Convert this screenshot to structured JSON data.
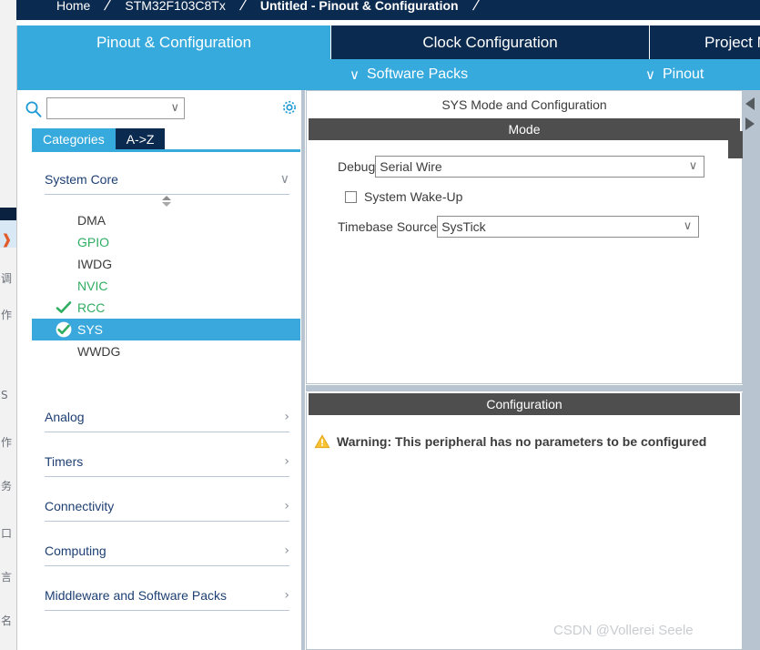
{
  "breadcrumb": {
    "items": [
      {
        "label": "Home",
        "current": false
      },
      {
        "label": "STM32F103C8Tx",
        "current": false
      },
      {
        "label": "Untitled - Pinout & Configuration",
        "current": true
      }
    ],
    "separator": "/"
  },
  "tabs": [
    {
      "label": "Pinout & Configuration",
      "active": true
    },
    {
      "label": "Clock Configuration",
      "active": false
    },
    {
      "label": "Project Manager",
      "active": false
    }
  ],
  "subtoolbar": {
    "software_packs": "Software Packs",
    "pinout": "Pinout",
    "chevron": "∨"
  },
  "sidebar": {
    "search": {
      "value": "",
      "placeholder": "",
      "icon": "search-icon",
      "chevron": "∨"
    },
    "gear_icon": "gear-icon",
    "view_tabs": [
      {
        "label": "Categories",
        "active": true
      },
      {
        "label": "A->Z",
        "active": false
      }
    ],
    "groups": [
      {
        "label": "System Core",
        "expanded": true,
        "chevron": "∨",
        "items": [
          {
            "label": "DMA",
            "state": "plain",
            "mark": "none"
          },
          {
            "label": "GPIO",
            "state": "green",
            "mark": "none"
          },
          {
            "label": "IWDG",
            "state": "plain",
            "mark": "none"
          },
          {
            "label": "NVIC",
            "state": "green",
            "mark": "none"
          },
          {
            "label": "RCC",
            "state": "check",
            "mark": "check"
          },
          {
            "label": "SYS",
            "state": "selected",
            "mark": "check-circle"
          },
          {
            "label": "WWDG",
            "state": "plain",
            "mark": "none"
          }
        ]
      },
      {
        "label": "Analog",
        "expanded": false,
        "chevron": "›",
        "items": []
      },
      {
        "label": "Timers",
        "expanded": false,
        "chevron": "›",
        "items": []
      },
      {
        "label": "Connectivity",
        "expanded": false,
        "chevron": "›",
        "items": []
      },
      {
        "label": "Computing",
        "expanded": false,
        "chevron": "›",
        "items": []
      },
      {
        "label": "Middleware and Software Packs",
        "expanded": false,
        "chevron": "›",
        "items": []
      }
    ]
  },
  "mode_pane": {
    "title": "SYS Mode and Configuration",
    "header": "Mode",
    "debug": {
      "label": "Debug",
      "value": "Serial Wire",
      "chevron": "∨"
    },
    "system_wakeup": {
      "label": "System Wake-Up",
      "checked": false
    },
    "timebase": {
      "label": "Timebase Source",
      "value": "SysTick",
      "chevron": "∨"
    }
  },
  "config_pane": {
    "header": "Configuration",
    "warning_icon": "warning-triangle-icon",
    "warning_text": "Warning: This peripheral has no parameters to be configured"
  },
  "edge_rail": {
    "collapse_left_icon": "arrow-left-icon",
    "collapse_right_icon": "arrow-right-icon"
  },
  "watermark": "CSDN @Vollerei Seele",
  "left_strip": {
    "glyphs": [
      "调",
      "作",
      "S",
      "作",
      "务",
      "口",
      "言",
      "名"
    ],
    "arrow_icon": "chevron-right-icon"
  },
  "colors": {
    "brand_blue": "#36a9dd",
    "navy": "#0b2a4f",
    "selected_row": "#3aa8dc",
    "green": "#2fae62",
    "header_gray": "#4e4e4e",
    "splitter": "#b8c4d0",
    "warning_amber": "#f2b01e"
  }
}
